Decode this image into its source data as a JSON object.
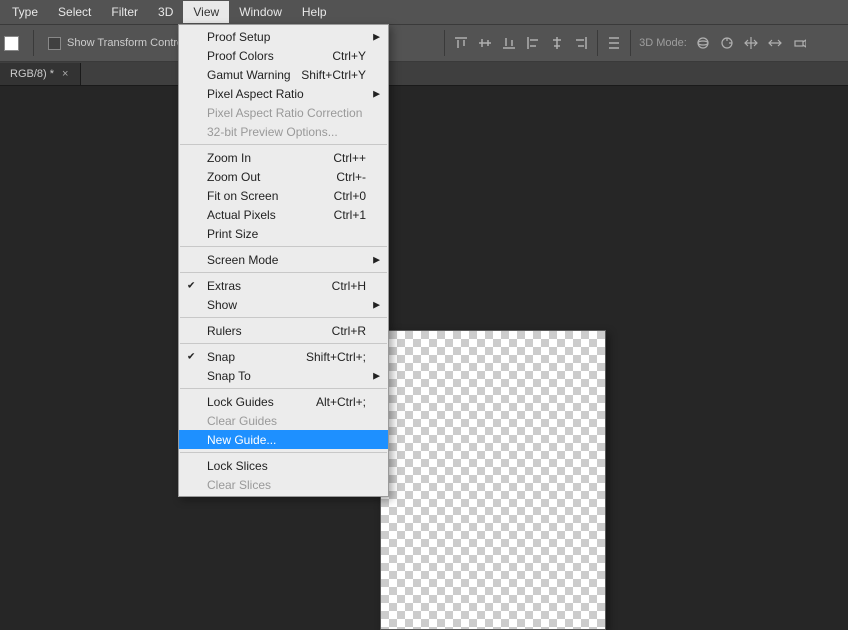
{
  "menubar": [
    "Type",
    "Select",
    "Filter",
    "3D",
    "View",
    "Window",
    "Help"
  ],
  "menubar_open_index": 4,
  "optbar": {
    "checkbox_label": "Show Transform Controls",
    "mode3d_label": "3D Mode:"
  },
  "tab": {
    "title": "RGB/8) *"
  },
  "menu": [
    {
      "label": "Proof Setup",
      "arrow": true
    },
    {
      "label": "Proof Colors",
      "shortcut": "Ctrl+Y"
    },
    {
      "label": "Gamut Warning",
      "shortcut": "Shift+Ctrl+Y"
    },
    {
      "label": "Pixel Aspect Ratio",
      "arrow": true
    },
    {
      "label": "Pixel Aspect Ratio Correction",
      "disabled": true
    },
    {
      "label": "32-bit Preview Options...",
      "disabled": true
    },
    {
      "sep": true
    },
    {
      "label": "Zoom In",
      "shortcut": "Ctrl++"
    },
    {
      "label": "Zoom Out",
      "shortcut": "Ctrl+-"
    },
    {
      "label": "Fit on Screen",
      "shortcut": "Ctrl+0"
    },
    {
      "label": "Actual Pixels",
      "shortcut": "Ctrl+1"
    },
    {
      "label": "Print Size"
    },
    {
      "sep": true
    },
    {
      "label": "Screen Mode",
      "arrow": true
    },
    {
      "sep": true
    },
    {
      "label": "Extras",
      "shortcut": "Ctrl+H",
      "check": true
    },
    {
      "label": "Show",
      "arrow": true
    },
    {
      "sep": true
    },
    {
      "label": "Rulers",
      "shortcut": "Ctrl+R"
    },
    {
      "sep": true
    },
    {
      "label": "Snap",
      "shortcut": "Shift+Ctrl+;",
      "check": true
    },
    {
      "label": "Snap To",
      "arrow": true
    },
    {
      "sep": true
    },
    {
      "label": "Lock Guides",
      "shortcut": "Alt+Ctrl+;"
    },
    {
      "label": "Clear Guides",
      "disabled": true
    },
    {
      "label": "New Guide...",
      "highlight": true
    },
    {
      "sep": true
    },
    {
      "label": "Lock Slices"
    },
    {
      "label": "Clear Slices",
      "disabled": true
    }
  ]
}
